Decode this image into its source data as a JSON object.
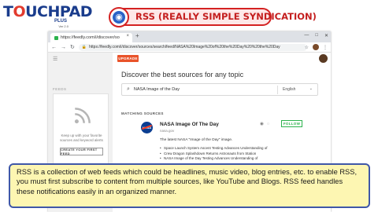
{
  "brand": {
    "name_part1": "T",
    "name_part2": "UCHPAD",
    "plus": "PLUS",
    "version": "Ver 2.0"
  },
  "title": {
    "text": "RSS (REALLY SIMPLE SYNDICATION)",
    "icon": "globe-icon"
  },
  "browser": {
    "tab": {
      "label": "https://feedly.com/i/discover/so",
      "close": "×"
    },
    "new_tab": "+",
    "url": "https://feedly.com/i/discover/sources/search/feed/NASA%20Image%20of%20the%20Day%20%20NASA%20Image%20of%20the%20Day",
    "url_display": "https://feedly.com/i/discover/sources/search/feed/NASA%20Image%20of%20the%20Day%20%20the%20Day"
  },
  "sidebar": {
    "feeds_label": "FEEDS",
    "text": "Keep up with your favorite sources and keyword alerts",
    "create_button": "CREATE YOUR FIRST FEED"
  },
  "main": {
    "upgrade": "UPGRADE",
    "heading": "Discover the best sources for any topic",
    "search_value": "NASA Image of the Day",
    "language": "English",
    "matching_sources": "MATCHING SOURCES",
    "result": {
      "title": "NASA Image Of The Day",
      "url": "nasa.gov",
      "logo_text": "NASA",
      "follow": "FOLLOW",
      "description": "The latest NASA \"Image of the Day\" image.",
      "items": [
        "Space Launch System Ascent Testing Advances Understanding of",
        "Crew Dragon Splashdown Returns Astronauts from Station",
        "NASA Image of the Day Testing Advances Understanding of"
      ]
    }
  },
  "caption": "RSS is a collection of web feeds which could be headlines, music video, blog entries, etc. to enable RSS, you must first subscribe to content from multiple sources, like YouTube and Blogs. RSS feed handles these notifications easily in an organized manner."
}
